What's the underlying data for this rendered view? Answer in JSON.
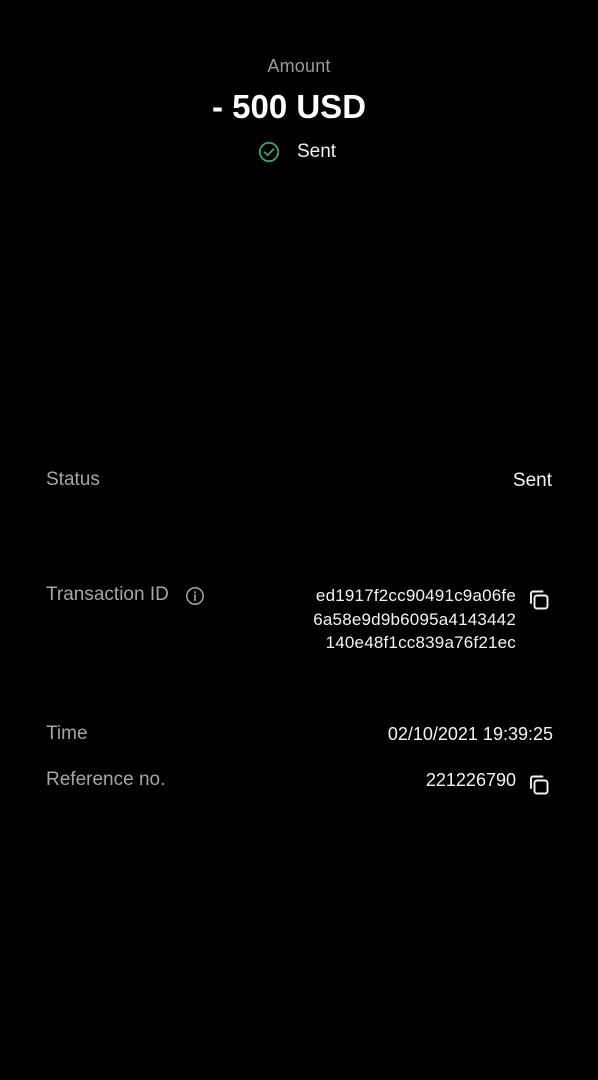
{
  "header": {
    "amount_label": "Amount",
    "amount_value": "- 500 USD",
    "status_label": "Sent",
    "status_icon": "check-circle-icon",
    "status_color": "#3fae6a"
  },
  "details": {
    "status": {
      "label": "Status",
      "value": "Sent"
    },
    "transaction_id": {
      "label": "Transaction ID",
      "info_icon": "info-icon",
      "lines": [
        "ed1917f2cc90491c9a06fe",
        "6a58e9d9b6095a4143442",
        "140e48f1cc839a76f21ec"
      ],
      "copy_icon": "copy-icon"
    },
    "time": {
      "label": "Time",
      "value": "02/10/2021 19:39:25"
    },
    "reference": {
      "label": "Reference no.",
      "value": "221226790",
      "copy_icon": "copy-icon"
    }
  }
}
